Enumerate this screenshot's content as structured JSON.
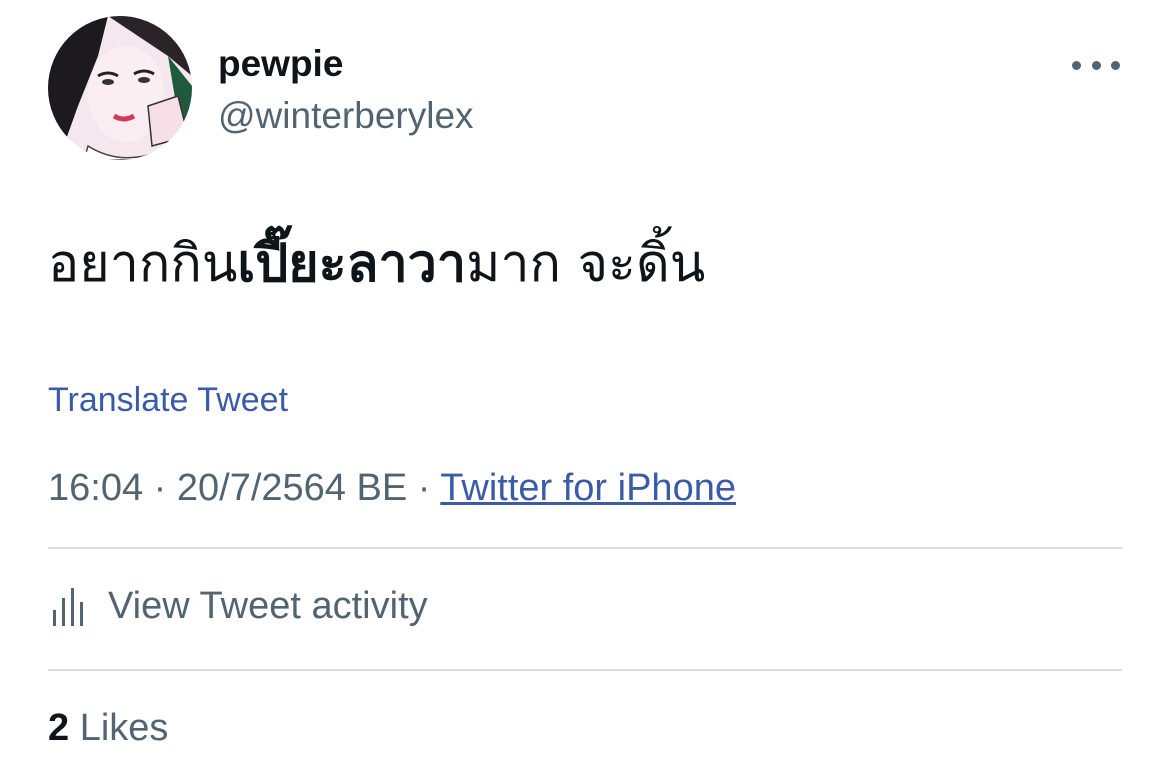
{
  "user": {
    "display_name": "pewpie",
    "handle": "@winterberylex",
    "avatar": "profile-photo"
  },
  "tweet": {
    "text_pre": "อยากกิน",
    "text_bold": "เปี๊ยะลาวา",
    "text_post": "มาก จะดิ้น"
  },
  "translate_label": "Translate Tweet",
  "meta": {
    "time": "16:04",
    "date": "20/7/2564 BE",
    "separator": "·",
    "source": "Twitter for iPhone"
  },
  "activity": {
    "label": "View Tweet activity",
    "icon": "bar-chart-icon"
  },
  "likes": {
    "count": "2",
    "label": "Likes"
  },
  "more_icon": "more-dots-icon",
  "colors": {
    "link": "#3b5ba8",
    "secondary_text": "#536471",
    "primary_text": "#0f1419",
    "divider": "#d6dce0"
  }
}
